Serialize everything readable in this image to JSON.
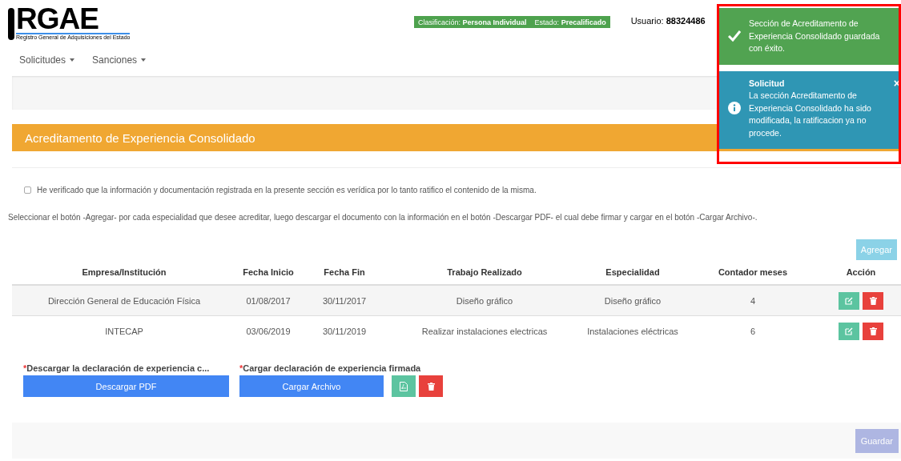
{
  "logo": {
    "mark": "RGAE",
    "subtitle": "Registro General de Adquisiciones del Estado"
  },
  "nav": [
    {
      "label": "Solicitudes"
    },
    {
      "label": "Sanciones"
    }
  ],
  "status_badge": [
    {
      "label": "Clasificación:",
      "value": "Persona Individual"
    },
    {
      "label": "Estado:",
      "value": "Precalificado"
    }
  ],
  "user": {
    "label": "Usuario:",
    "value": "88324486"
  },
  "section": {
    "title": "Acreditamento de Experiencia Consolidado"
  },
  "ratify": {
    "checked": false,
    "label": "He verificado que la información y documentación registrada en la presente sección es verídica por lo tanto ratifico el contenido de la misma."
  },
  "instructions": "Seleccionar el botón -Agregar- por cada especialidad que desee acreditar, luego descargar el documento con la información en el botón -Descargar PDF- el cual debe firmar y cargar en el botón -Cargar Archivo-.",
  "add_button": {
    "label": "Agregar",
    "disabled": true
  },
  "table": {
    "columns": [
      "Empresa/Institución",
      "Fecha Inicio",
      "Fecha Fin",
      "Trabajo Realizado",
      "Especialidad",
      "Contador meses",
      "Acción"
    ],
    "rows": [
      {
        "cells": [
          "Dirección General de Educación Física",
          "01/08/2017",
          "30/11/2017",
          "Diseño gráfico",
          "Diseño gráfico",
          "4"
        ]
      },
      {
        "cells": [
          "INTECAP",
          "03/06/2019",
          "30/11/2019",
          "Realizar instalaciones electricas",
          "Instalaciones eléctricas",
          "6"
        ]
      }
    ]
  },
  "download": {
    "required": "*",
    "label": "Descargar la declaración de experiencia c...",
    "button": "Descargar PDF"
  },
  "upload": {
    "required": "*",
    "label": "Cargar declaración de experiencia firmada",
    "button": "Cargar Archivo"
  },
  "save_button": {
    "label": "Guardar",
    "disabled": true
  },
  "toasts": [
    {
      "kind": "success",
      "message": "Sección de Acreditamento de Experiencia Consolidado guardada con éxito."
    },
    {
      "kind": "info",
      "title": "Solicitud",
      "message": "La sección Acreditamento de Experiencia Consolidado ha sido modificada, la ratificacion ya no procede.",
      "close": "×"
    }
  ]
}
